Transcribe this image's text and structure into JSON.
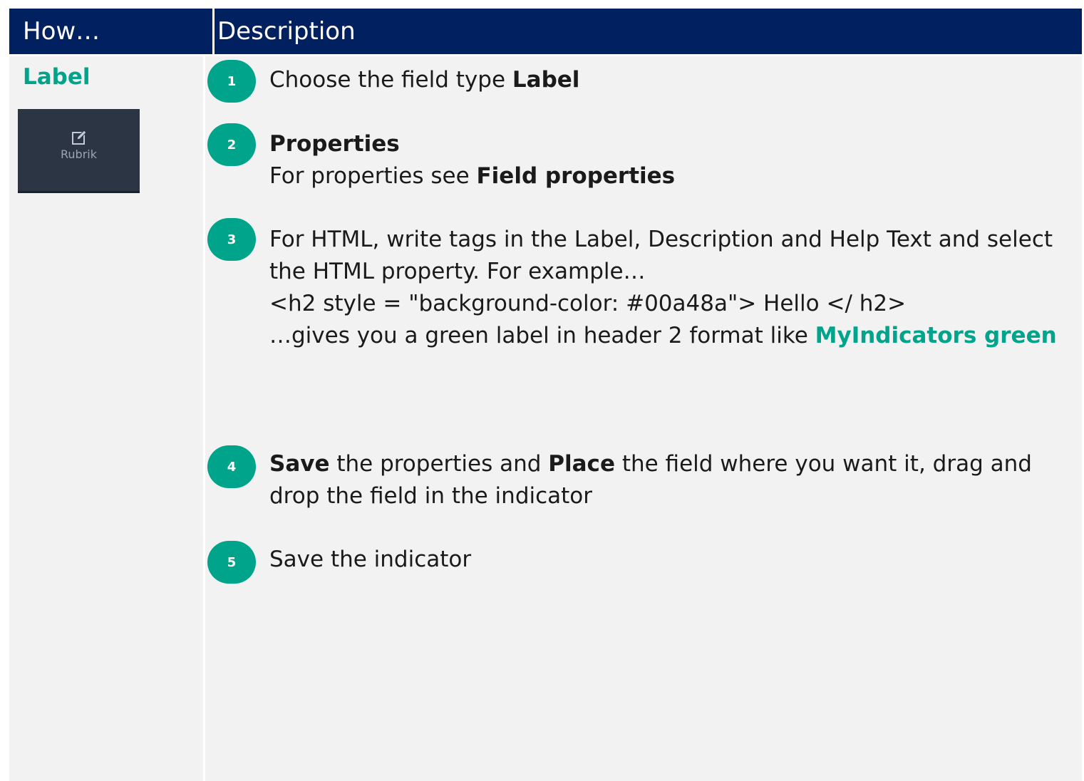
{
  "header": {
    "how": "How…",
    "description": "Description"
  },
  "left": {
    "label": "Label",
    "button_label": "Rubrik",
    "button_icon": "edit-icon"
  },
  "steps": [
    {
      "number": "1",
      "text_a": "Choose the field type ",
      "text_b": "Label"
    },
    {
      "number": "2",
      "title": "Properties",
      "text_a": "For properties see ",
      "text_b": "Field properties"
    },
    {
      "number": "3",
      "line1": "For HTML, write tags in the Label, Description and Help Text and select the HTML property. For example…",
      "line2": "<h2 style = \"background-color: #00a48a\"> Hello </ h2>",
      "line3": "…gives you a green label in header 2 format like ",
      "line3_green": "MyIndicators green"
    },
    {
      "number": "4",
      "save": "Save",
      "text_a": " the properties and ",
      "place": "Place",
      "text_b": " the field where you want it, drag and drop the field in the indicator"
    },
    {
      "number": "5",
      "text": "Save the indicator"
    }
  ],
  "colors": {
    "header_bg": "#002060",
    "accent": "#00a48a",
    "panel_bg": "#f2f2f2",
    "button_bg": "#2b3544"
  }
}
